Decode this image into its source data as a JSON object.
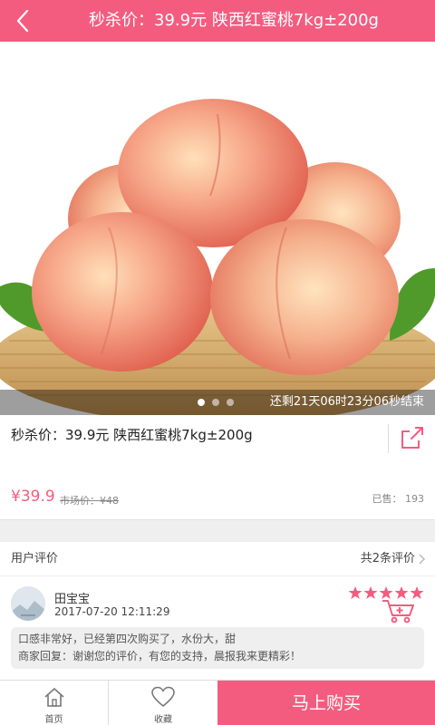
{
  "header": {
    "title": "秒杀价：39.9元 陕西红蜜桃7kg±200g",
    "back_icon": "back-arrow-icon"
  },
  "hero": {
    "countdown": "还剩21天06时23分06秒结束",
    "carousel_dots": 3,
    "active_dot": 1
  },
  "product": {
    "title": "秒杀价：39.9元 陕西红蜜桃7kg±200g",
    "price": "¥39.9",
    "market_price": "市场价：¥48",
    "sold": "已售： 193",
    "share_icon": "share-icon"
  },
  "reviews": {
    "label": "用户评价",
    "count": "共2条评价",
    "items": [
      {
        "name": "田宝宝",
        "time": "2017-07-20 12:11:29",
        "rating": 5,
        "comment": "口感非常好，已经第四次购买了，水份大，甜",
        "reply": "商家回复：谢谢您的评价，有您的支持，晨报我来更精彩！"
      }
    ]
  },
  "bottom": {
    "home_label": "首页",
    "fav_label": "收藏",
    "buy_label": "马上购买"
  },
  "colors": {
    "accent": "#f45c7f"
  }
}
